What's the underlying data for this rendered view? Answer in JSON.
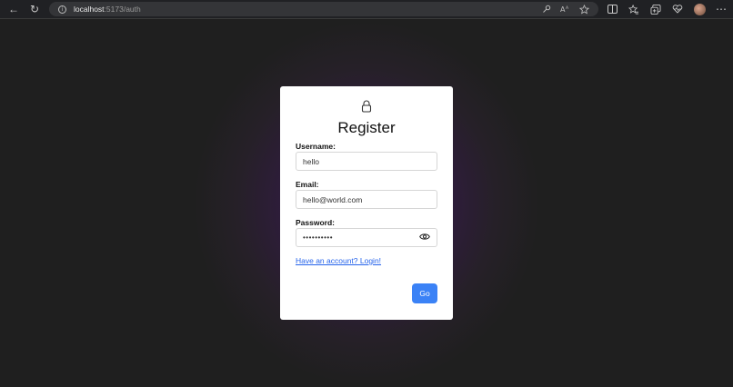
{
  "browser": {
    "url_host": "localhost",
    "url_path": ":5173/auth",
    "info_glyph": "i",
    "back_icon": "←",
    "reload_icon": "↻",
    "more_icon": "⋯",
    "addr_icons": [
      "key-icon",
      "read-aloud-icon",
      "favorite-star-icon"
    ],
    "toolbar_icons": [
      "split-screen-icon",
      "favorites-icon",
      "collections-icon",
      "heart-icon",
      "profile-avatar",
      "more-icon"
    ]
  },
  "colors": {
    "accent": "#3b82f6",
    "link": "#2563eb",
    "background": "#1f1f1f",
    "glow": "#3a1e4e"
  },
  "form": {
    "title": "Register",
    "username": {
      "label": "Username:",
      "value": "hello"
    },
    "email": {
      "label": "Email:",
      "value": "hello@world.com"
    },
    "password": {
      "label": "Password:",
      "value": "••••••••••"
    },
    "login_link": "Have an account? Login!",
    "submit_label": "Go"
  }
}
